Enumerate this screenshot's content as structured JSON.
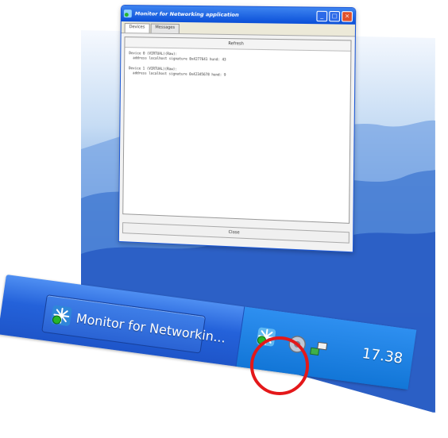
{
  "window": {
    "title": "Monitor for Networking application",
    "tabs": [
      "Devices",
      "Messages"
    ],
    "refresh_label": "Refresh",
    "devices": [
      {
        "line1": "Device 0 (VIRTUAL)(Raw):",
        "line2": "  address localhost signature 0x4277641 hund: 43"
      },
      {
        "line1": "Device 1 (VIRTUAL)(Raw):",
        "line2": "  address localhost signature 0x42345678 hund: 9"
      }
    ],
    "close_label": "Close"
  },
  "taskbar": {
    "task_label": "Monitor for Networkin...",
    "clock": "17.38"
  },
  "tray_icons": [
    "network-monitor-icon",
    "volume-icon",
    "network-connection-icon"
  ],
  "colors": {
    "taskbar_blue": "#2462da",
    "tray_blue": "#1276d7",
    "highlight_red": "#e4181a"
  }
}
